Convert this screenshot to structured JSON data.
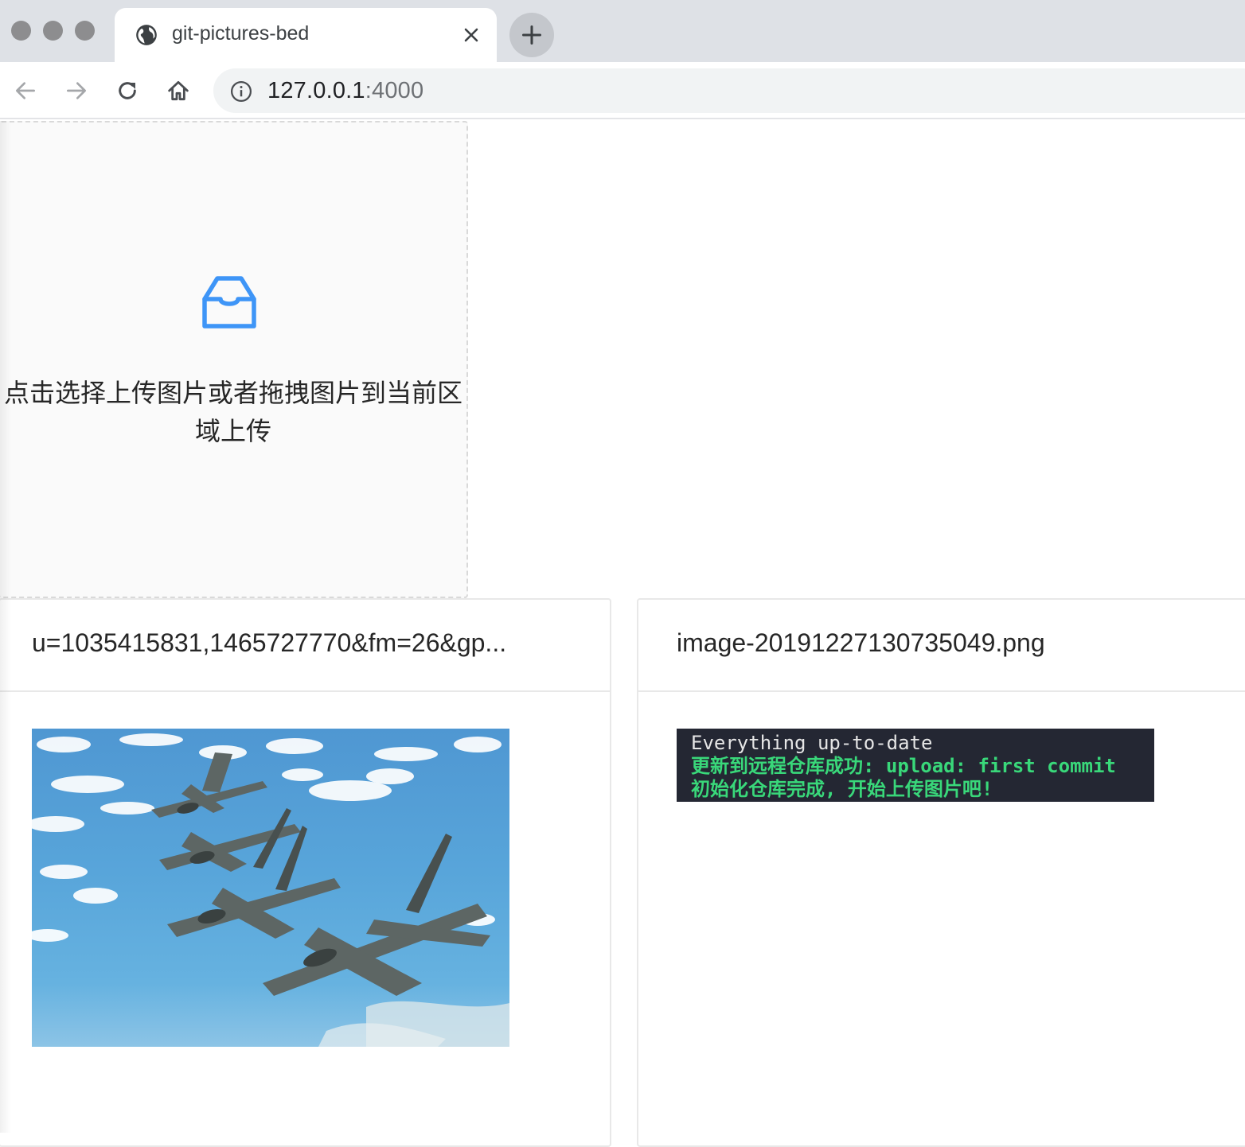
{
  "browser": {
    "tab": {
      "title": "git-pictures-bed"
    },
    "address_bar": {
      "host": "127.0.0.1",
      "port": ":4000"
    }
  },
  "upload": {
    "icon": "inbox-icon",
    "accent_color": "#3e95f7",
    "text": "点击选择上传图片或者拖拽图片到当前区域上传"
  },
  "cards": [
    {
      "title": "u=1035415831,1465727770&fm=26&gp...",
      "image": "fighter-jets-photo"
    },
    {
      "title": "image-20191227130735049.png",
      "image": "terminal-screenshot",
      "terminal_lines": [
        "Everything up-to-date",
        "更新到远程仓库成功: upload: first commit",
        "初始化仓库完成, 开始上传图片吧!"
      ]
    }
  ]
}
